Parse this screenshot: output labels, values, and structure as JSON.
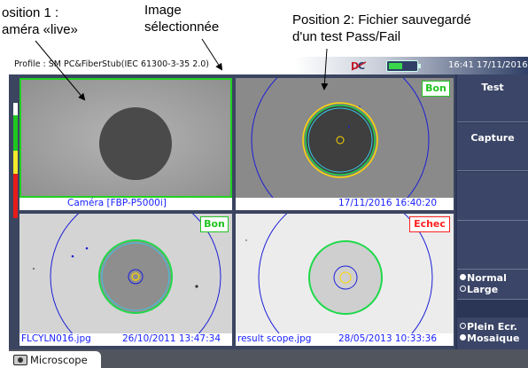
{
  "annotations": {
    "position1_line1": "osition 1 :",
    "position1_line2": "améra «live»",
    "image_line1": "Image",
    "image_line2": "sélectionnée",
    "position2_line1": "Position 2: Fichier sauvegardé",
    "position2_line2": "d'un test Pass/Fail"
  },
  "statusbar": {
    "profile": "Profile : SM PC&FiberStub(IEC 61300-3-35 2.0)",
    "time": "16:41 17/11/2016",
    "logo_icon": "brand-logo-icon",
    "battery_icon": "battery-icon",
    "battery_level": 0.5
  },
  "panels": {
    "live": {
      "caption_left": "Caméra [FBP-P5000i]",
      "caption_right": ""
    },
    "saved1": {
      "badge": "Bon",
      "caption_left": "",
      "caption_right": "17/11/2016 16:40:20"
    },
    "file1": {
      "badge": "Bon",
      "caption_left": "FLCYLN016.jpg",
      "caption_right": "26/10/2011 13:47:34"
    },
    "file2": {
      "badge": "Echec",
      "caption_left": "result scope.jpg",
      "caption_right": "28/05/2013 10:33:36"
    }
  },
  "sidebar": {
    "test_label": "Test",
    "capture_label": "Capture",
    "size_options": [
      "Normal",
      "Large"
    ],
    "size_selected": "Normal",
    "view_options": [
      "Plein Ecr.",
      "Mosaique"
    ],
    "view_selected": "Mosaique"
  },
  "bottom": {
    "tab_label": "Microscope",
    "tab_icon": "microscope-icon"
  },
  "colors": {
    "pass": "#22c422",
    "fail": "#ff2020",
    "caption_text": "#1a22ff",
    "selection_border": "#20d020",
    "zone_core": "#ffd700",
    "zone_cladding": "#1fd84a",
    "zone_contact": "#1b1fd6"
  }
}
